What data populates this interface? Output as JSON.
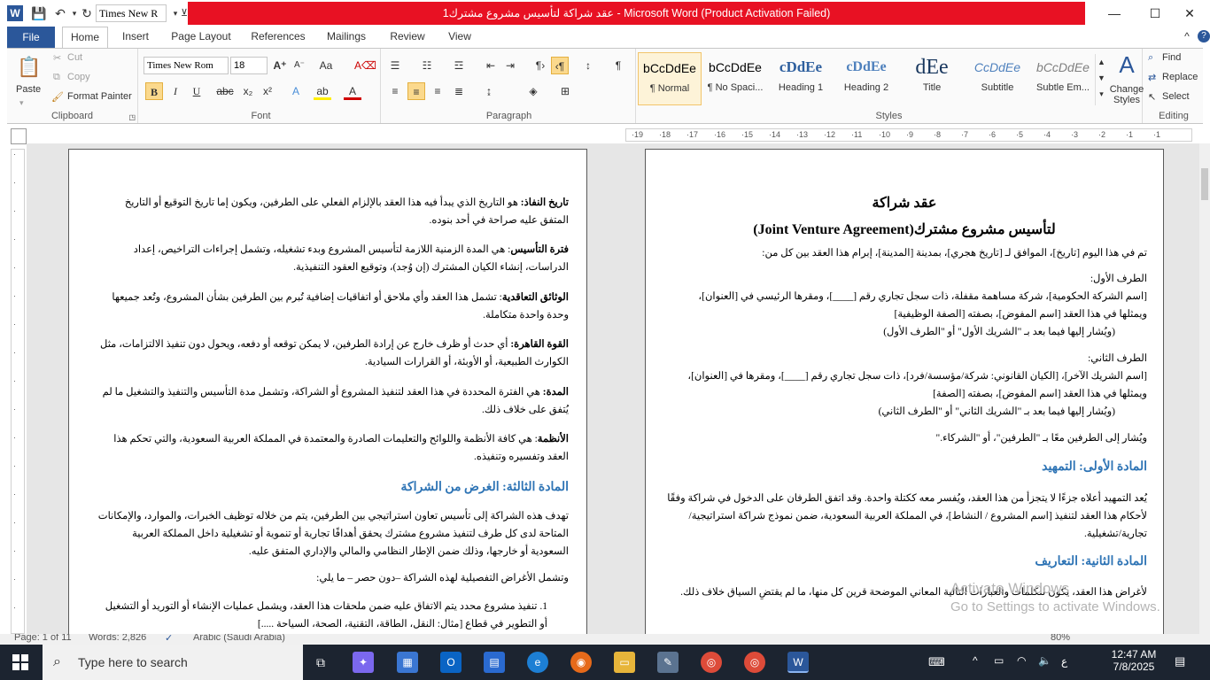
{
  "window": {
    "title": "عقد شراكة لتأسيس مشروع مشترك1  -  Microsoft Word (Product Activation Failed)",
    "qa_font": "Times New R"
  },
  "tabs": [
    "File",
    "Home",
    "Insert",
    "Page Layout",
    "References",
    "Mailings",
    "Review",
    "View"
  ],
  "ribbon": {
    "clipboard": {
      "label": "Clipboard",
      "paste": "Paste",
      "cut": "Cut",
      "copy": "Copy",
      "format_painter": "Format Painter"
    },
    "font": {
      "label": "Font",
      "name": "Times New Rom",
      "size": "18"
    },
    "paragraph": {
      "label": "Paragraph"
    },
    "styles": {
      "label": "Styles",
      "items": [
        {
          "preview": "bCcDdEe",
          "name": "¶ Normal"
        },
        {
          "preview": "bCcDdEe",
          "name": "¶ No Spaci..."
        },
        {
          "preview": "cDdEe",
          "name": "Heading 1"
        },
        {
          "preview": "cDdEe",
          "name": "Heading 2"
        },
        {
          "preview": "dEe",
          "name": "Title"
        },
        {
          "preview": "CcDdEe",
          "name": "Subtitle"
        },
        {
          "preview": "bCcDdEe",
          "name": "Subtle Em..."
        }
      ],
      "change_styles": "Change Styles"
    },
    "editing": {
      "label": "Editing",
      "find": "Find",
      "replace": "Replace",
      "select": "Select"
    }
  },
  "ruler": {
    "h_ticks": [
      "19",
      "18",
      "17",
      "16",
      "15",
      "14",
      "13",
      "12",
      "11",
      "10",
      "9",
      "8",
      "7",
      "6",
      "5",
      "4",
      "3",
      "2",
      "1",
      "1"
    ]
  },
  "left_page": [
    {
      "term": "تاريخ النفاذ:",
      "body": " هو التاريخ الذي يبدأ فيه هذا العقد بالإلزام الفعلي على الطرفين، ويكون إما تاريخ التوقيع أو التاريخ المتفق عليه صراحة في أحد بنوده."
    },
    {
      "term": "فترة التأسيس",
      "body": ": هي المدة الزمنية اللازمة لتأسيس المشروع وبدء تشغيله، وتشمل إجراءات التراخيص، إعداد الدراسات، إنشاء الكيان المشترك (إن وُجد)، وتوقيع العقود التنفيذية."
    },
    {
      "term": "الوثائق التعاقدية",
      "body": ": تشمل هذا العقد وأي ملاحق أو اتفاقيات إضافية تُبرم بين الطرفين بشأن المشروع، وتُعد جميعها وحدة واحدة متكاملة."
    },
    {
      "term": "القوة القاهرة:",
      "body": " أي حدث أو ظرف خارج عن إرادة الطرفين، لا يمكن توقعه أو دفعه، ويحول دون تنفيذ الالتزامات، مثل الكوارث الطبيعية، أو الأوبئة، أو القرارات السيادية."
    },
    {
      "term": "المدة:",
      "body": " هي الفترة المحددة في هذا العقد لتنفيذ المشروع أو الشراكة، وتشمل مدة التأسيس والتنفيذ والتشغيل ما لم يُتفق على خلاف ذلك."
    },
    {
      "term": "الأنظمة",
      "body": ": هي كافة الأنظمة واللوائح والتعليمات الصادرة والمعتمدة في المملكة العربية السعودية، والتي تحكم هذا العقد وتفسيره وتنفيذه."
    }
  ],
  "left_heading": "المادة الثالثة: الغرض من الشراكة",
  "left_purpose": "تهدف هذه الشراكة إلى تأسيس تعاون استراتيجي بين الطرفين، يتم من خلاله توظيف الخبرات، والموارد، والإمكانات المتاحة لدى كل طرف لتنفيذ مشروع مشترك يحقق أهدافًا تجارية أو تنموية أو تشغيلية داخل المملكة العربية السعودية أو خارجها، وذلك ضمن الإطار النظامي والمالي والإداري المتفق عليه.",
  "left_goals": "وتشمل الأغراض التفصيلية لهذه الشراكة –دون حصر – ما يلي:",
  "left_item1": "1.   تنفيذ مشروع محدد يتم الاتفاق عليه ضمن ملحقات هذا العقد، ويشمل عمليات الإنشاء أو التوريد أو التشغيل أو التطوير في قطاع [مثال: النقل، الطاقة، التقنية، الصحة، السياحة .....]",
  "right_page": {
    "title1": "عقد شراكة",
    "title2": "لتأسيس مشروع مشترك(Joint Venture Agreement)",
    "intro": "تم في هذا اليوم [تاريخ]، الموافق لـ [تاريخ هجري]، بمدينة [المدينة]، إبرام هذا العقد بين كل من:",
    "party1_label": "الطرف الأول:",
    "party1_line1": "[اسم الشركة الحكومية]، شركة مساهمة مقفلة، ذات سجل تجاري رقم [____]، ومقرها الرئيسي في [العنوان]،",
    "party1_line2": "ويمثلها في هذا العقد [اسم المفوض]، بصفته [الصفة الوظيفية]",
    "party1_line3": "(ويُشار إليها فيما بعد بـ \"الشريك الأول\" أو \"الطرف الأول)",
    "party2_label": "الطرف الثاني:",
    "party2_line1": "[اسم الشريك الآخر]، [الكيان القانوني: شركة/مؤسسة/فرد]، ذات سجل تجاري رقم [____]، ومقرها في [العنوان]،",
    "party2_line2": "ويمثلها في هذا العقد [اسم المفوض]، بصفته [الصفة]",
    "party2_line3": "(ويُشار إليها فيما بعد بـ \"الشريك الثاني\" أو \"الطرف الثاني)",
    "parties_note": "ويُشار إلى الطرفين معًا بـ \"الطرفين\"، أو \"الشركاء.\"",
    "heading1": "المادة الأولى: التمهيد",
    "preamble": "يُعد التمهيد أعلاه جزءًا لا يتجزأ من هذا العقد، ويُفسر معه ككتلة واحدة. وقد اتفق الطرفان على الدخول في شراكة وفقًا لأحكام هذا العقد لتنفيذ [اسم المشروع / النشاط]، في المملكة العربية السعودية، ضمن نموذج شراكة استراتيجية/تجارية/تشغيلية.",
    "heading2": "المادة الثانية: التعاريف",
    "definitions_intro": "لأغراض هذا العقد، يكون للكلمات والعبارات التالية المعاني الموضحة قرين كل منها، ما لم يقتضِ السياق خلاف ذلك."
  },
  "statusbar": {
    "page": "Page: 1 of 11",
    "words": "Words: 2,826",
    "lang": "Arabic (Saudi Arabia)",
    "zoom": "80%"
  },
  "activation": {
    "line1": "Activate Windows",
    "line2": "Go to Settings to activate Windows."
  },
  "taskbar": {
    "search_placeholder": "Type here to search",
    "time": "12:47 AM",
    "date": "7/8/2025",
    "lang": "ع"
  }
}
